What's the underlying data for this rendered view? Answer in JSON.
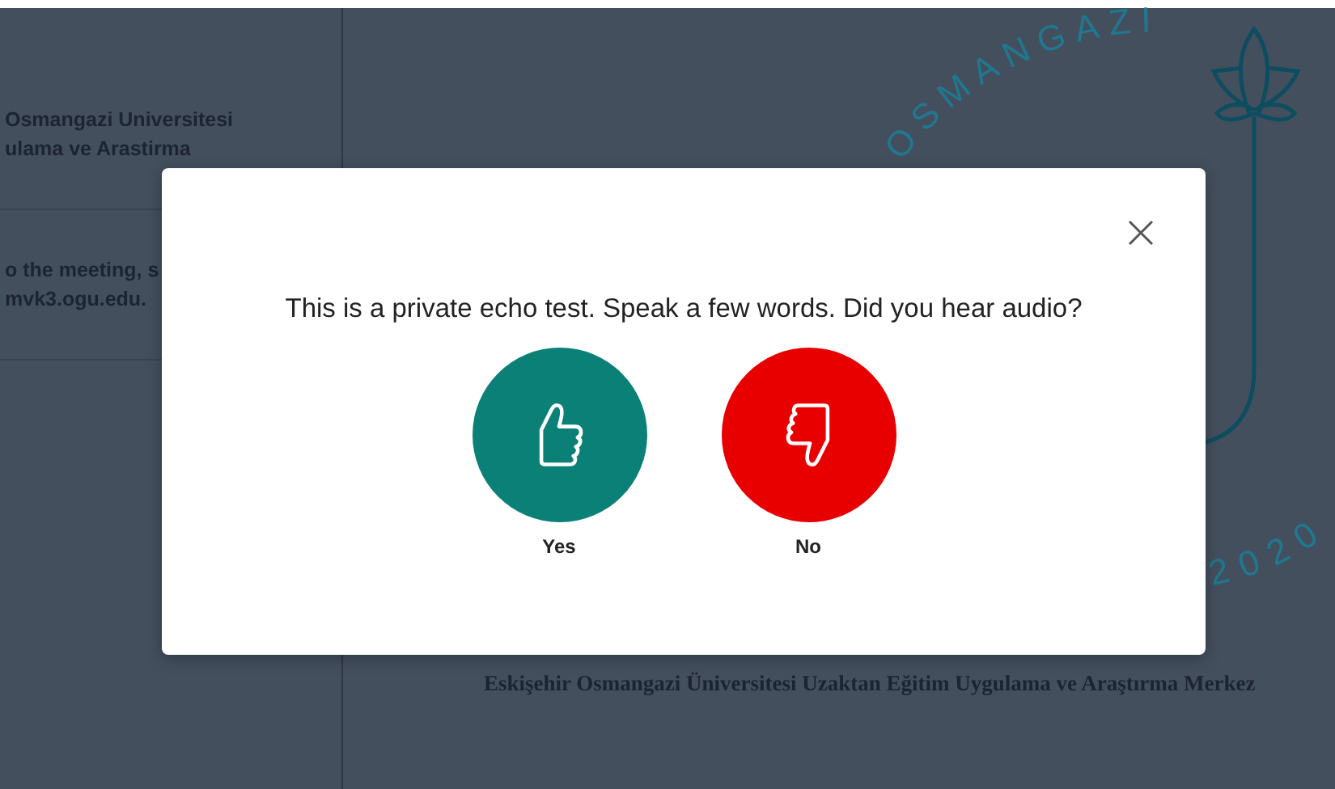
{
  "sidebar": {
    "items": [
      {
        "lines": [
          "Osmangazi Universitesi",
          "ulama ve Arastirma"
        ]
      },
      {
        "lines": [
          "o the meeting, s",
          "mvk3.ogu.edu."
        ]
      }
    ]
  },
  "main": {
    "logo": {
      "arc_text": "OSMANGAZI",
      "year": "2020"
    },
    "caption": "Eskişehir Osmangazi Üniversitesi Uzaktan Eğitim Uygulama ve Araştırma Merkez"
  },
  "modal": {
    "question": "This is a private echo test. Speak a few words. Did you hear audio?",
    "options": [
      {
        "kind": "yes",
        "label": "Yes"
      },
      {
        "kind": "no",
        "label": "No"
      }
    ]
  }
}
